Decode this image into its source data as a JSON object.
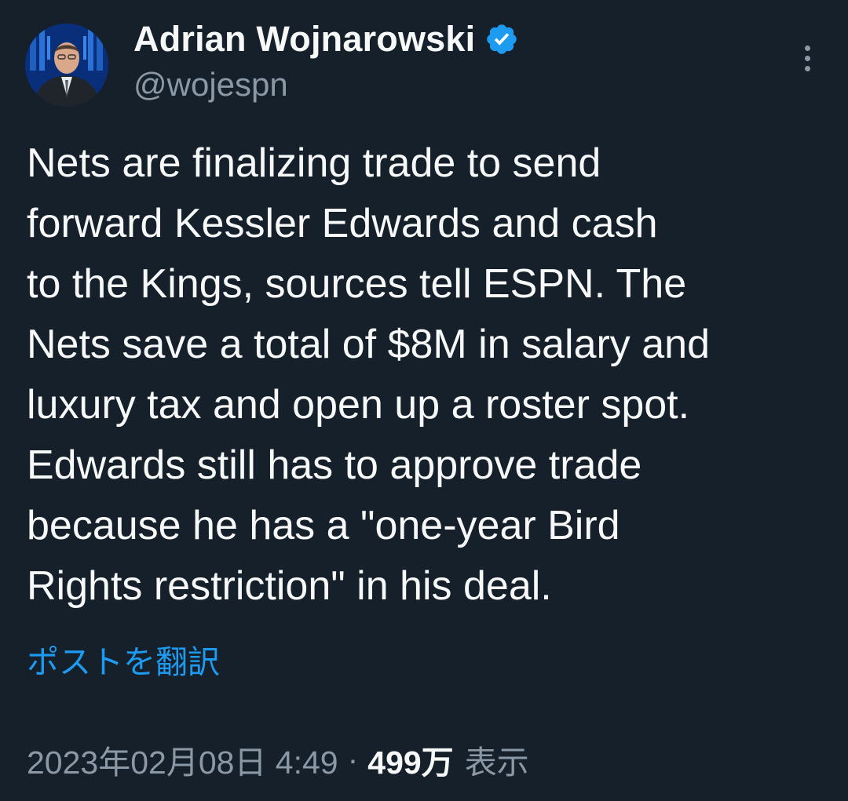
{
  "author": {
    "display_name": "Adrian Wojnarowski",
    "handle": "@wojespn",
    "verified_icon": "verified-badge-icon",
    "accent_color": "#1d9bf0"
  },
  "menu": {
    "more_icon": "more-vertical-icon"
  },
  "tweet": {
    "lines": [
      "Nets are finalizing trade to send",
      "forward Kessler Edwards and cash",
      "to the Kings, sources tell ESPN. The",
      "Nets save a total of $8M in salary and",
      "luxury tax and open up a roster spot.",
      "Edwards still has to approve trade",
      "because he has a \"one-year Bird",
      "Rights restriction\" in his deal."
    ],
    "translate_label": "ポストを翻訳"
  },
  "meta": {
    "timestamp": "2023年02月08日 4:49",
    "separator": "·",
    "views_count": "499万",
    "views_label": "表示"
  },
  "colors": {
    "background": "#15202b",
    "primary_text": "#f7f9f9",
    "secondary_text": "#8b98a5",
    "link": "#1d9bf0"
  }
}
